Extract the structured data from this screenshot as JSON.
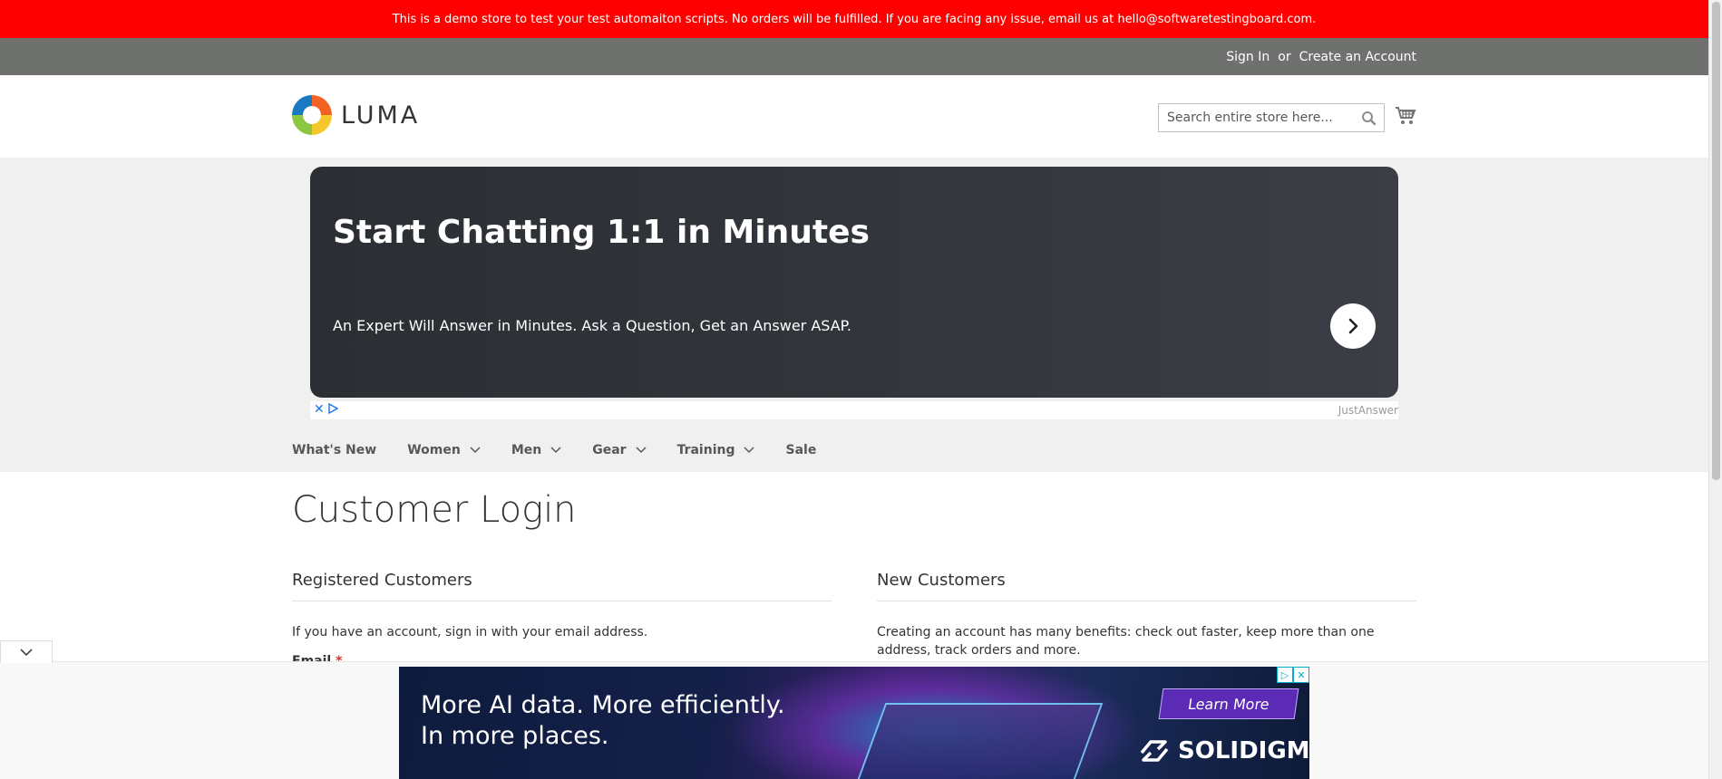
{
  "demo_notice": "This is a demo store to test your test automaiton scripts. No orders will be fulfilled. If you are facing any issue, email us at hello@softwaretestingboard.com.",
  "header_links": {
    "sign_in": "Sign In",
    "or": "or",
    "create_account": "Create an Account"
  },
  "logo": {
    "text": "LUMA",
    "icon": "luma-logo-icon"
  },
  "search": {
    "placeholder": "Search entire store here...",
    "icon": "search-icon"
  },
  "cart": {
    "icon": "cart-icon"
  },
  "top_ad": {
    "title": "Start Chatting 1:1 in Minutes",
    "subtitle": "An Expert Will Answer in Minutes. Ask a Question, Get an Answer ASAP.",
    "advertiser": "JustAnswer",
    "close_glyph": "✕"
  },
  "nav": {
    "items": [
      {
        "label": "What's New",
        "has_submenu": false
      },
      {
        "label": "Women",
        "has_submenu": true
      },
      {
        "label": "Men",
        "has_submenu": true
      },
      {
        "label": "Gear",
        "has_submenu": true
      },
      {
        "label": "Training",
        "has_submenu": true
      },
      {
        "label": "Sale",
        "has_submenu": false
      }
    ]
  },
  "page": {
    "title": "Customer Login",
    "registered": {
      "title": "Registered Customers",
      "text": "If you have an account, sign in with your email address.",
      "email_label": "Email",
      "required_mark": "*"
    },
    "new_customers": {
      "title": "New Customers",
      "text": "Creating an account has many benefits: check out faster, keep more than one address, track orders and more."
    }
  },
  "bottom_ad": {
    "headline_1": "More AI data. More efficiently.",
    "headline_2": "In more places.",
    "cta": "Learn More",
    "brand": "SOLIDIGM."
  },
  "colors": {
    "notice_bg": "#ff0000",
    "panel_bg": "#6e716e",
    "band_bg": "#f0f0f0",
    "required": "#e02b27"
  }
}
